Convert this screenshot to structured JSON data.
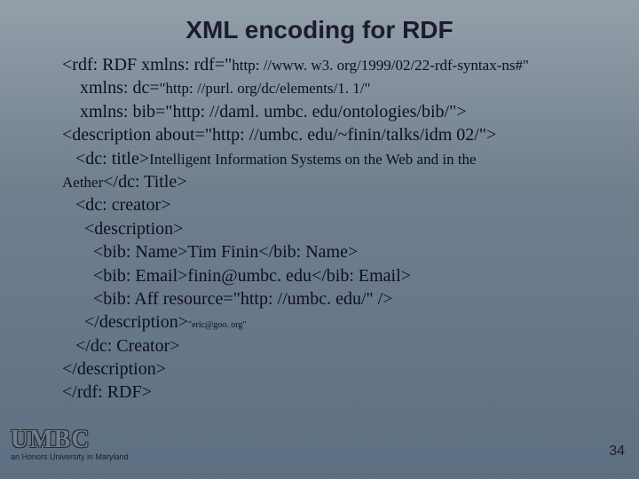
{
  "title": "XML encoding for RDF",
  "code": {
    "l1a": "<rdf: RDF xmlns: rdf=\"",
    "l1b": "http: //www. w3. org/1999/02/22-rdf-syntax-ns#\"",
    "l2a": "    xmlns: dc=",
    "l2b": "\"http: //purl. org/dc/elements/1. 1/\"",
    "l3": "    xmlns: bib=\"http: //daml. umbc. edu/ontologies/bib/\">",
    "l4": "<description about=\"http: //umbc. edu/~finin/talks/idm 02/\">",
    "l5a": "   <dc: title>",
    "l5b": "Intelligent Information Systems on the Web and in the",
    "l6a": "Aether",
    "l6b": "</dc: Title>",
    "l7": "   <dc: creator>",
    "l8": "     <description>",
    "l9": "       <bib: Name>Tim Finin</bib: Name>",
    "l10": "       <bib: Email>finin@umbc. edu</bib: Email>",
    "l11": "       <bib: Aff resource=\"http: //umbc. edu/\" />",
    "l12a": "     </description>",
    "l12b": "\"eric@goo. org\"",
    "l13": "   </dc: Creator>",
    "l14": "</description>",
    "l15": "</rdf: RDF>"
  },
  "footer": {
    "brand": "UMBC",
    "tagline": "an Honors University in Maryland",
    "page": "34"
  }
}
